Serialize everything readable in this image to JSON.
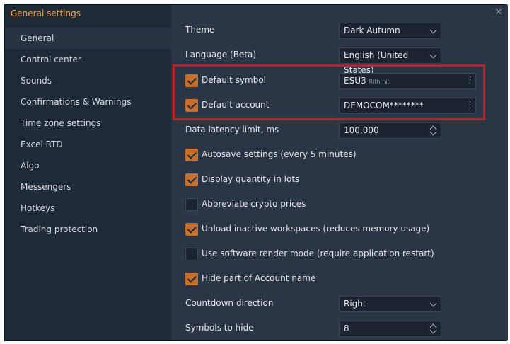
{
  "window": {
    "title": "General settings"
  },
  "sidebar": {
    "items": [
      {
        "label": "General",
        "active": true
      },
      {
        "label": "Control center"
      },
      {
        "label": "Sounds"
      },
      {
        "label": "Confirmations & Warnings"
      },
      {
        "label": "Time zone settings"
      },
      {
        "label": "Excel RTD"
      },
      {
        "label": "Algo"
      },
      {
        "label": "Messengers"
      },
      {
        "label": "Hotkeys"
      },
      {
        "label": "Trading protection"
      }
    ]
  },
  "settings": {
    "theme": {
      "label": "Theme",
      "value": "Dark Autumn"
    },
    "language": {
      "label": "Language (Beta)",
      "value": "English (United States)"
    },
    "default_symbol": {
      "label": "Default symbol",
      "checked": true,
      "value": "ESU3",
      "sub": "Rithmic"
    },
    "default_account": {
      "label": "Default account",
      "checked": true,
      "value": "DEMOCOM********"
    },
    "latency": {
      "label": "Data latency limit, ms",
      "value": "100,000"
    },
    "autosave": {
      "label": "Autosave settings (every 5 minutes)",
      "checked": true
    },
    "lots": {
      "label": "Display quantity in lots",
      "checked": true
    },
    "crypto": {
      "label": "Abbreviate crypto prices",
      "checked": false
    },
    "unload": {
      "label": "Unload inactive workspaces (reduces memory usage)",
      "checked": true
    },
    "render": {
      "label": "Use software render mode (require application restart)",
      "checked": false
    },
    "hide_account": {
      "label": "Hide part of Account name",
      "checked": true
    },
    "countdown": {
      "label": "Countdown direction",
      "value": "Right"
    },
    "symbols_hide": {
      "label": "Symbols to hide",
      "value": "8"
    }
  },
  "icons": {
    "close": "close-icon",
    "dropdown": "chevron-down-icon",
    "menu": "kebab-menu-icon",
    "spinner": "spinner-arrows-icon"
  },
  "colors": {
    "accent": "#f0a04b",
    "checkbox": "#c6702e",
    "highlight": "#d7141a"
  }
}
